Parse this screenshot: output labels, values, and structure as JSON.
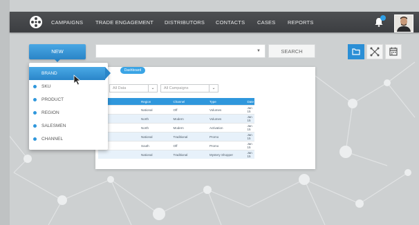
{
  "nav": {
    "items": [
      "CAMPAIGNS",
      "TRADE ENGAGEMENT",
      "DISTRIBUTORS",
      "CONTACTS",
      "CASES",
      "REPORTS"
    ]
  },
  "toolbar": {
    "new_label": "NEW",
    "search_value": "",
    "search_label": "SEARCH"
  },
  "menu": {
    "items": [
      {
        "label": "BRAND",
        "active": true
      },
      {
        "label": "SKU"
      },
      {
        "label": "PRODUCT"
      },
      {
        "label": "REGION"
      },
      {
        "label": "SALESMEN"
      },
      {
        "label": "CHANNEL"
      }
    ]
  },
  "panel": {
    "tab_label": "ge",
    "tab_pill": "Dashboard",
    "filters": [
      "All Data",
      "All Campaigns"
    ],
    "table": {
      "headers": [
        "",
        "Region",
        "Channel",
        "Type",
        "Date"
      ],
      "rows": [
        [
          "",
          "National",
          "Off",
          "Volumes",
          "Jan 15"
        ],
        [
          "",
          "North",
          "Modern",
          "Volumes",
          "Jan 15"
        ],
        [
          "",
          "North",
          "Modern",
          "Activation",
          "Jan 15"
        ],
        [
          "",
          "National",
          "Traditional",
          "Promo",
          "Jan 15"
        ],
        [
          "",
          "South",
          "Off",
          "Promo",
          "Jan 15"
        ],
        [
          "",
          "National",
          "Traditional",
          "Mystery Shopper",
          "Jan 15"
        ]
      ]
    }
  },
  "colors": {
    "accent": "#2f97dc",
    "topbar": "#414346",
    "background": "#cfd2d3"
  }
}
